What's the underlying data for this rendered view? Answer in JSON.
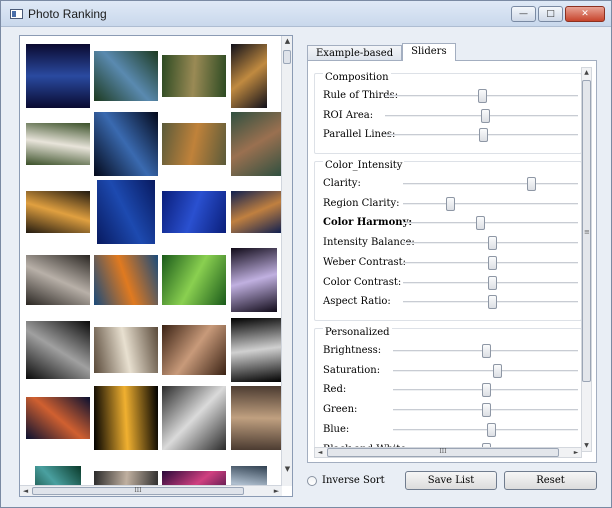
{
  "window": {
    "title": "Photo Ranking",
    "buttons": {
      "minimize": "—",
      "maximize": "□",
      "close": "✕"
    }
  },
  "photos": [
    {
      "desc": "night-bridge",
      "c": [
        "#0a0a30",
        "#2a4aa0"
      ]
    },
    {
      "desc": "dragonfly",
      "c": [
        "#1d3a20",
        "#5a8ab0"
      ]
    },
    {
      "desc": "grass-seed",
      "c": [
        "#2c4a22",
        "#9a8a55"
      ]
    },
    {
      "desc": "ferris-wheel",
      "c": [
        "#10101a",
        "#c08a40"
      ]
    },
    {
      "desc": "eagle",
      "c": [
        "#3a5028",
        "#e8e4da"
      ]
    },
    {
      "desc": "capitol-night",
      "c": [
        "#03081a",
        "#3a6ab0"
      ]
    },
    {
      "desc": "tiger",
      "c": [
        "#5a5a3a",
        "#c0823a"
      ]
    },
    {
      "desc": "clock",
      "c": [
        "#305040",
        "#9a7050"
      ]
    },
    {
      "desc": "sunset-city",
      "c": [
        "#221a10",
        "#e0a040"
      ]
    },
    {
      "desc": "cyclist-silhouette",
      "c": [
        "#081a60",
        "#1d4ab0"
      ]
    },
    {
      "desc": "blue-sparkles",
      "c": [
        "#0a1e7a",
        "#2a50d0"
      ]
    },
    {
      "desc": "harbor-dusk",
      "c": [
        "#102050",
        "#c08040"
      ]
    },
    {
      "desc": "cathedral-bw",
      "c": [
        "#2a2622",
        "#b8b0a8"
      ]
    },
    {
      "desc": "goldfish",
      "c": [
        "#1a4a7a",
        "#e07a20"
      ]
    },
    {
      "desc": "frog-leaf",
      "c": [
        "#1a5a1a",
        "#8ad050"
      ]
    },
    {
      "desc": "white-flower",
      "c": [
        "#100a18",
        "#c0b0e0"
      ]
    },
    {
      "desc": "skyline-night",
      "c": [
        "#0a0a0a",
        "#a0a0a0"
      ]
    },
    {
      "desc": "wall-hook",
      "c": [
        "#5a4a3a",
        "#e8e0d0"
      ]
    },
    {
      "desc": "old-woman",
      "c": [
        "#3a2214",
        "#c89a7a"
      ]
    },
    {
      "desc": "dandelion-bw",
      "c": [
        "#000000",
        "#d0d0d0"
      ]
    },
    {
      "desc": "golden-gate",
      "c": [
        "#0a1030",
        "#d06030"
      ]
    },
    {
      "desc": "flower-vase",
      "c": [
        "#000000",
        "#f0b030"
      ]
    },
    {
      "desc": "hooded-child-bw",
      "c": [
        "#2a2a2a",
        "#dadada"
      ]
    },
    {
      "desc": "brick-building",
      "c": [
        "#4a3a30",
        "#c0a080"
      ]
    },
    {
      "desc": "aerial-coast",
      "c": [
        "#0a3a2a",
        "#4aa0a0"
      ]
    },
    {
      "desc": "spiral",
      "c": [
        "#2a2a2a",
        "#c0b0a0"
      ]
    },
    {
      "desc": "purple-sky",
      "c": [
        "#2a0a3a",
        "#d04080"
      ]
    },
    {
      "desc": "tower-clouds",
      "c": [
        "#304050",
        "#b0c0d0"
      ]
    }
  ],
  "photo_scrollbar": {
    "h_grip": "III"
  },
  "tabs": [
    {
      "label": "Example-based",
      "active": false
    },
    {
      "label": "Sliders",
      "active": true
    }
  ],
  "groups": [
    {
      "title": "Composition",
      "sliders": [
        {
          "label": "Rule of Thirds:",
          "value": 0.5,
          "bold": false
        },
        {
          "label": "ROI Area:",
          "value": 0.52,
          "bold": false
        },
        {
          "label": "Parallel Lines:",
          "value": 0.51,
          "bold": false
        }
      ]
    },
    {
      "title": "Color_Intensity",
      "sliders": [
        {
          "label": "Clarity:",
          "value": 0.73,
          "bold": false
        },
        {
          "label": "Region Clarity:",
          "value": 0.27,
          "bold": false
        },
        {
          "label": "Color Harmony:",
          "value": 0.44,
          "bold": true
        },
        {
          "label": "Intensity Balance:",
          "value": 0.51,
          "bold": false
        },
        {
          "label": "Weber Contrast:",
          "value": 0.51,
          "bold": false
        },
        {
          "label": "Color Contrast:",
          "value": 0.51,
          "bold": false
        },
        {
          "label": "Aspect Ratio:",
          "value": 0.51,
          "bold": false
        }
      ]
    },
    {
      "title": "Personalized",
      "sliders": [
        {
          "label": "Brightness:",
          "value": 0.5,
          "bold": false
        },
        {
          "label": "Saturation:",
          "value": 0.56,
          "bold": false
        },
        {
          "label": "Red:",
          "value": 0.5,
          "bold": false
        },
        {
          "label": "Green:",
          "value": 0.5,
          "bold": false
        },
        {
          "label": "Blue:",
          "value": 0.53,
          "bold": false
        },
        {
          "label": "Black and White:",
          "value": 0.5,
          "bold": false
        }
      ]
    }
  ],
  "slider_scrollbar": {
    "h_grip": "III",
    "v_grip": "≡"
  },
  "bottom": {
    "inverse_sort_label": "Inverse Sort",
    "save_label": "Save List",
    "reset_label": "Reset"
  },
  "colors": {
    "chrome": "#e9eef5",
    "border": "#8b9bb4"
  }
}
